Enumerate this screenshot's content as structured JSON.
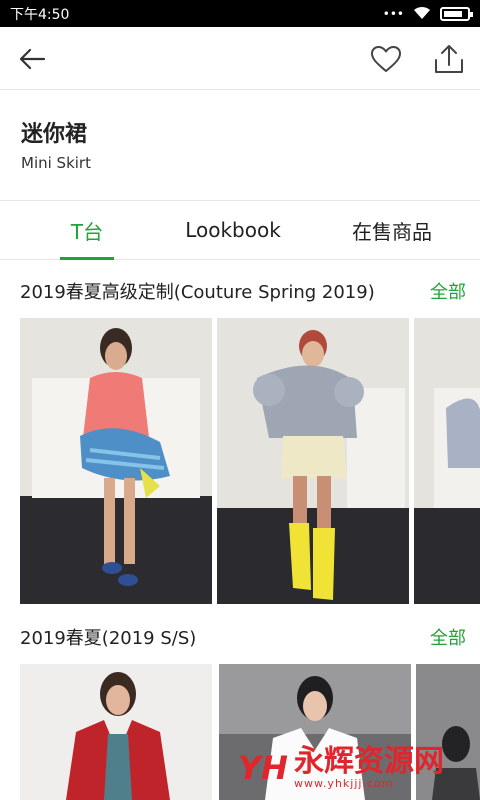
{
  "status_bar": {
    "time": "下午4:50",
    "dots": "•••",
    "signal_icon": "wifi-icon",
    "battery_icon": "battery-icon"
  },
  "toolbar": {
    "back_icon": "arrow-left-icon",
    "favorite_icon": "heart-icon",
    "share_icon": "share-icon"
  },
  "header": {
    "title_cn": "迷你裙",
    "title_en": "Mini Skirt"
  },
  "tabs": [
    {
      "label": "T台",
      "active": true
    },
    {
      "label": "Lookbook",
      "active": false
    },
    {
      "label": "在售商品",
      "active": false
    }
  ],
  "sections": [
    {
      "title": "2019春夏高级定制(Couture Spring 2019)",
      "more": "全部"
    },
    {
      "title": "2019春夏(2019 S/S)",
      "more": "全部"
    }
  ],
  "watermark": {
    "logo": "YH",
    "text": "永辉资源网",
    "url": "www.yhkjjj.com"
  },
  "colors": {
    "accent": "#22a33a",
    "watermark": "#e0262c"
  }
}
